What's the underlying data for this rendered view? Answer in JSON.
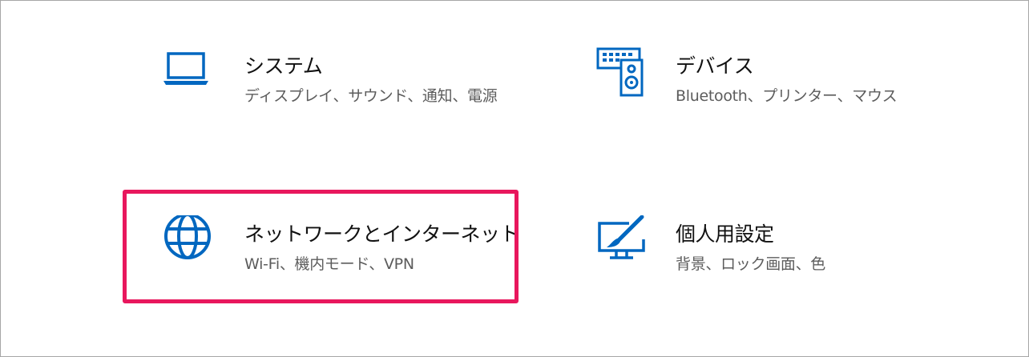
{
  "settings_tiles": {
    "system": {
      "title": "システム",
      "desc": "ディスプレイ、サウンド、通知、電源",
      "icon": "laptop-icon"
    },
    "devices": {
      "title": "デバイス",
      "desc": "Bluetooth、プリンター、マウス",
      "icon": "keyboard-speaker-icon"
    },
    "network": {
      "title": "ネットワークとインターネット",
      "desc": "Wi-Fi、機内モード、VPN",
      "icon": "globe-icon"
    },
    "personalization": {
      "title": "個人用設定",
      "desc": "背景、ロック画面、色",
      "icon": "monitor-brush-icon"
    }
  },
  "colors": {
    "icon_blue": "#0067c0",
    "highlight": "#e8175d"
  }
}
